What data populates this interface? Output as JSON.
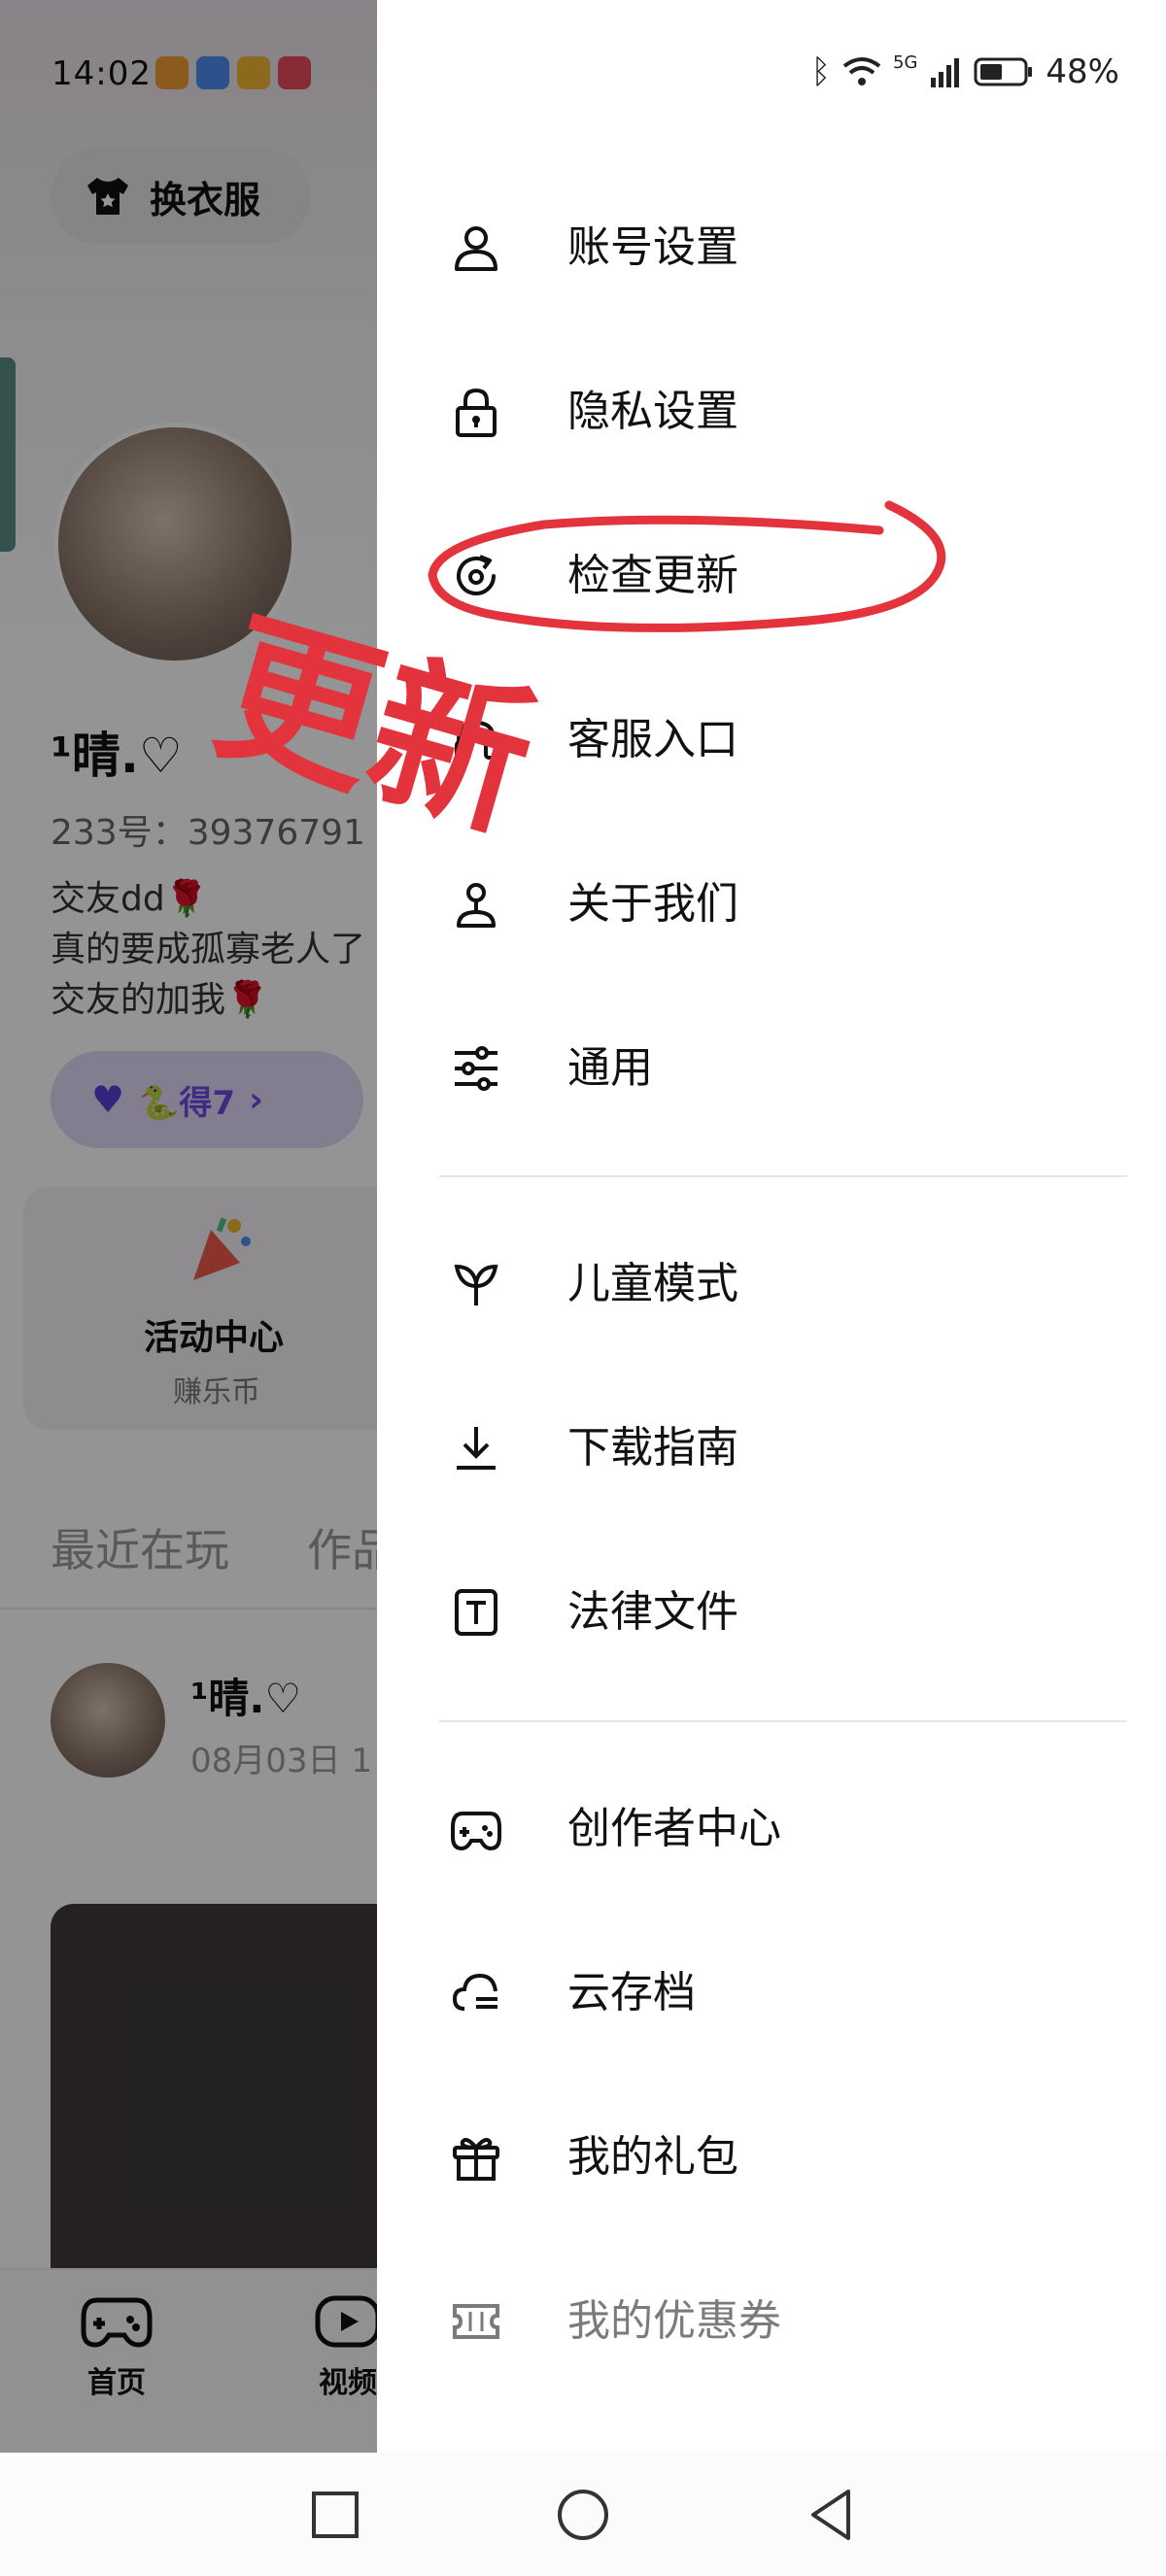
{
  "status_bar": {
    "time": "14:02",
    "battery": "48%",
    "network": "5G"
  },
  "background": {
    "outfit_button": "换衣服",
    "username": "¹晴.♡",
    "uid": "233号：39376791",
    "bio": [
      "交友dd🌹",
      "真的要成孤寡老人了",
      "交友的加我🌹"
    ],
    "badge_text": "🐍得7",
    "activity": {
      "title": "活动中心",
      "subtitle": "赚乐币"
    },
    "tabs": [
      "最近在玩",
      "作品"
    ],
    "post": {
      "name": "¹晴.♡",
      "date": "08月03日 1"
    },
    "bottom_nav": [
      {
        "label": "首页",
        "icon": "gamepad-icon"
      },
      {
        "label": "视频",
        "icon": "video-play-icon"
      }
    ]
  },
  "drawer": {
    "items": [
      {
        "label": "账号设置",
        "icon": "user-icon"
      },
      {
        "label": "隐私设置",
        "icon": "lock-icon"
      },
      {
        "label": "检查更新",
        "icon": "refresh-check-icon"
      },
      {
        "label": "客服入口",
        "icon": "headset-icon"
      },
      {
        "label": "关于我们",
        "icon": "about-person-icon"
      },
      {
        "label": "通用",
        "icon": "sliders-icon"
      },
      {
        "label": "儿童模式",
        "icon": "sprout-icon"
      },
      {
        "label": "下载指南",
        "icon": "download-icon"
      },
      {
        "label": "法律文件",
        "icon": "document-t-icon"
      },
      {
        "label": "创作者中心",
        "icon": "gamepad-icon"
      },
      {
        "label": "云存档",
        "icon": "cloud-icon"
      },
      {
        "label": "我的礼包",
        "icon": "gift-icon"
      },
      {
        "label": "我的优惠券",
        "icon": "coupon-icon"
      }
    ]
  },
  "annotation": {
    "text": "更新",
    "color": "#e3333c"
  },
  "colors": {
    "accent_purple": "#6a4ce0",
    "annotation_red": "#e3333c",
    "divider": "#e6e6e6"
  }
}
